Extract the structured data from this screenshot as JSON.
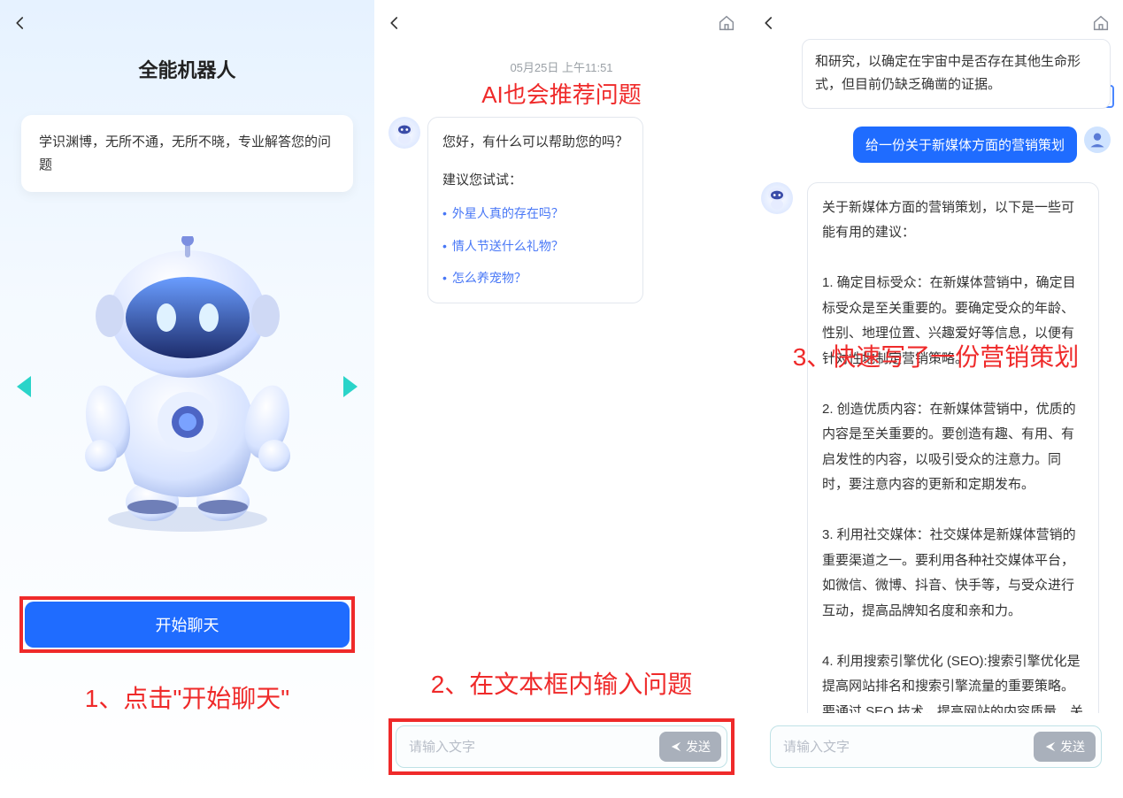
{
  "panel1": {
    "title": "全能机器人",
    "card_text": "学识渊博，无所不通，无所不晓，专业解答您的问题",
    "start_label": "开始聊天",
    "caption": "1、点击\"开始聊天\""
  },
  "panel2": {
    "timestamp": "05月25日  上午11:51",
    "caption_top": "AI也会推荐问题",
    "greeting": "您好，有什么可以帮助您的吗？",
    "suggest_header": "建议您试试：",
    "suggestions": [
      "外星人真的存在吗？",
      "情人节送什么礼物？",
      "怎么养宠物？"
    ],
    "caption_bottom": "2、在文本框内输入问题",
    "input_placeholder": "请输入文字",
    "send_label": "发送"
  },
  "panel3": {
    "prev_tail": "和研究，以确定在宇宙中是否存在其他生命形式，但目前仍缺乏确凿的证据。",
    "user_msg": "给一份关于新媒体方面的营销策划",
    "answer": "关于新媒体方面的营销策划，以下是一些可能有用的建议：\n\n1. 确定目标受众：在新媒体营销中，确定目标受众是至关重要的。要确定受众的年龄、性别、地理位置、兴趣爱好等信息，以便有针对性地制定营销策略。\n\n2. 创造优质内容：在新媒体营销中，优质的内容是至关重要的。要创造有趣、有用、有启发性的内容，以吸引受众的注意力。同时，要注意内容的更新和定期发布。\n\n3. 利用社交媒体：社交媒体是新媒体营销的重要渠道之一。要利用各种社交媒体平台，如微信、微博、抖音、快手等，与受众进行互动，提高品牌知名度和亲和力。\n\n4. 利用搜索引擎优化 (SEO):搜索引擎优化是提高网站排名和搜索引擎流量的重要策略。要通过 SEO 技术，提高网站的内容质量、关键词密度和网站结构等，以提高网站的排名和流量。",
    "caption": "3、快速写了一份营销策划",
    "input_placeholder": "请输入文字",
    "send_label": "发送"
  }
}
